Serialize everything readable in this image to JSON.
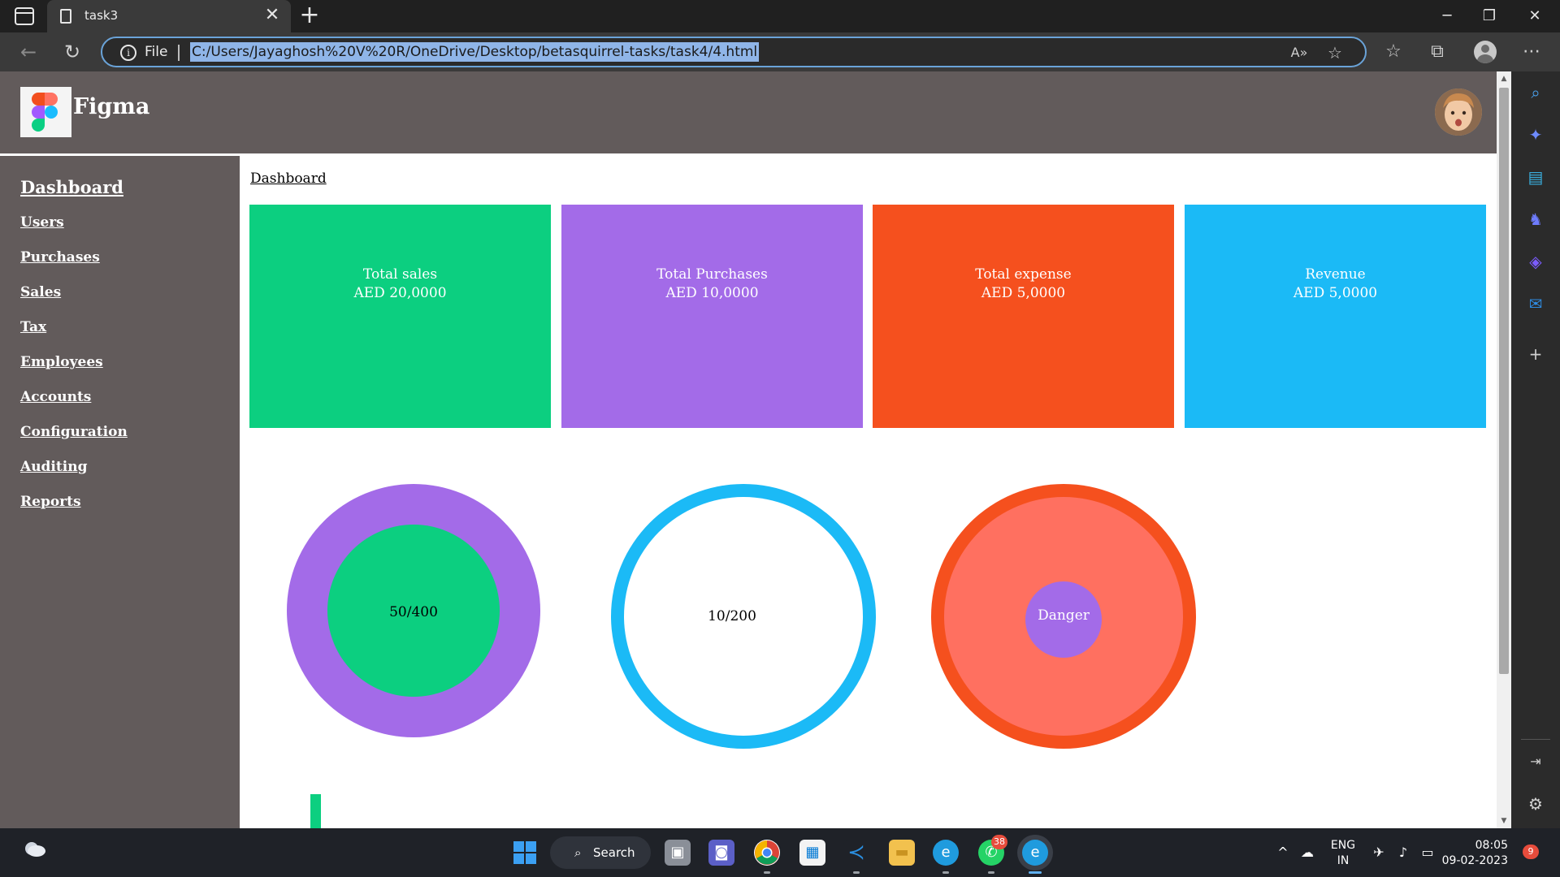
{
  "browser": {
    "tab_title": "task3",
    "file_label": "File",
    "url": "C:/Users/Jayaghosh%20V%20R/OneDrive/Desktop/betasquirrel-tasks/task4/4.html"
  },
  "page": {
    "brand": "Figma",
    "sidebar": {
      "title": "Dashboard",
      "items": [
        {
          "label": "Users"
        },
        {
          "label": "Purchases"
        },
        {
          "label": "Sales"
        },
        {
          "label": "Tax"
        },
        {
          "label": "Employees"
        },
        {
          "label": "Accounts"
        },
        {
          "label": "Configuration"
        },
        {
          "label": "Auditing"
        },
        {
          "label": "Reports"
        }
      ]
    },
    "breadcrumb": "Dashboard",
    "cards": [
      {
        "title": "Total sales",
        "value": "AED 20,0000",
        "color": "#0ccf80"
      },
      {
        "title": "Total Purchases",
        "value": "AED 10,0000",
        "color": "#a36be8"
      },
      {
        "title": "Total expense",
        "value": "AED 5,0000",
        "color": "#f5501e"
      },
      {
        "title": "Revenue",
        "value": "AED 5,0000",
        "color": "#1bbaf6"
      }
    ],
    "rings": [
      {
        "label": "50/400",
        "outer": "#a36be8",
        "inner": "#0ccf80"
      },
      {
        "label": "10/200",
        "outer": "#1bbaf6",
        "inner": "#ffffff"
      },
      {
        "label": "Danger",
        "outer": "#f5501e",
        "inner": "#ff7060",
        "center": "#a36be8"
      }
    ]
  },
  "taskbar": {
    "search_label": "Search",
    "whatsapp_badge": "38",
    "notification_badge": "9",
    "lang_primary": "ENG",
    "lang_secondary": "IN",
    "time": "08:05",
    "date": "09-02-2023"
  }
}
